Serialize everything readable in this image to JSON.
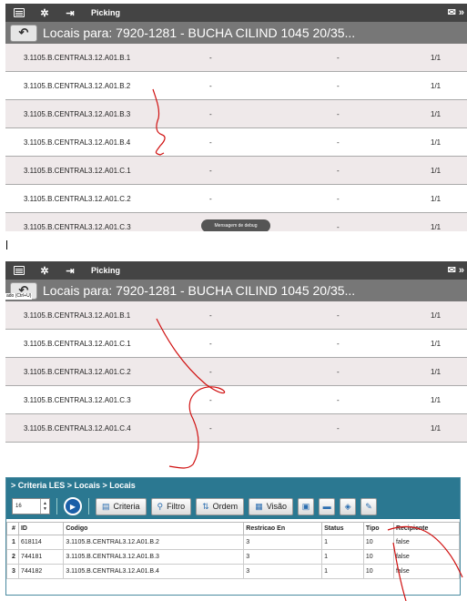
{
  "screen1": {
    "topbar": {
      "title": "Picking",
      "right_icon": "inbox-icon",
      "right_text": "»"
    },
    "titlebar": {
      "back_icon": "↶",
      "title": "Locais para: 7920-1281 - BUCHA CILIND 1045 20/35..."
    },
    "rows": [
      {
        "code": "3.1105.B.CENTRAL3.12.A01.B.1",
        "col2": "-",
        "col3": "-",
        "qty": "1/1"
      },
      {
        "code": "3.1105.B.CENTRAL3.12.A01.B.2",
        "col2": "-",
        "col3": "-",
        "qty": "1/1"
      },
      {
        "code": "3.1105.B.CENTRAL3.12.A01.B.3",
        "col2": "-",
        "col3": "-",
        "qty": "1/1"
      },
      {
        "code": "3.1105.B.CENTRAL3.12.A01.B.4",
        "col2": "-",
        "col3": "-",
        "qty": "1/1"
      },
      {
        "code": "3.1105.B.CENTRAL3.12.A01.C.1",
        "col2": "-",
        "col3": "-",
        "qty": "1/1"
      },
      {
        "code": "3.1105.B.CENTRAL3.12.A01.C.2",
        "col2": "-",
        "col3": "-",
        "qty": "1/1"
      },
      {
        "code": "3.1105.B.CENTRAL3.12.A01.C.3",
        "col2": "-",
        "col3": "-",
        "qty": "1/1"
      }
    ],
    "debug_label": "Mensagem de debug"
  },
  "screen2": {
    "topbar": {
      "title": "Picking",
      "right_text": "»"
    },
    "titlebar": {
      "back_icon": "↶",
      "title": "Locais para: 7920-1281 - BUCHA CILIND 1045 20/35...",
      "tooltip": "ado (Ctrl+U)"
    },
    "rows": [
      {
        "code": "3.1105.B.CENTRAL3.12.A01.B.1",
        "col2": "-",
        "col3": "-",
        "qty": "1/1"
      },
      {
        "code": "3.1105.B.CENTRAL3.12.A01.C.1",
        "col2": "-",
        "col3": "-",
        "qty": "1/1"
      },
      {
        "code": "3.1105.B.CENTRAL3.12.A01.C.2",
        "col2": "-",
        "col3": "-",
        "qty": "1/1"
      },
      {
        "code": "3.1105.B.CENTRAL3.12.A01.C.3",
        "col2": "-",
        "col3": "-",
        "qty": "1/1"
      },
      {
        "code": "3.1105.B.CENTRAL3.12.A01.C.4",
        "col2": "-",
        "col3": "-",
        "qty": "1/1"
      }
    ]
  },
  "grid": {
    "breadcrumb": "> Criteria LES > Locais > Locais",
    "page_size": "16",
    "buttons": {
      "criteria": "Criteria",
      "filtro": "Filtro",
      "ordem": "Ordem",
      "visao": "Visão"
    },
    "columns": [
      "#",
      "ID",
      "Codigo",
      "Restricao En",
      "Status",
      "Tipo",
      "Recipiente"
    ],
    "rows": [
      [
        "1",
        "618114",
        "3.1105.B.CENTRAL3.12.A01.B.2",
        "3",
        "1",
        "10",
        "false"
      ],
      [
        "2",
        "744181",
        "3.1105.B.CENTRAL3.12.A01.B.3",
        "3",
        "1",
        "10",
        "false"
      ],
      [
        "3",
        "744182",
        "3.1105.B.CENTRAL3.12.A01.B.4",
        "3",
        "1",
        "10",
        "false"
      ]
    ]
  },
  "colors": {
    "topbar": "#444444",
    "titlebar": "#777777",
    "row_alt": "#efe9ea",
    "grid_header": "#2b7891",
    "annotation_ink": "#d01010"
  }
}
